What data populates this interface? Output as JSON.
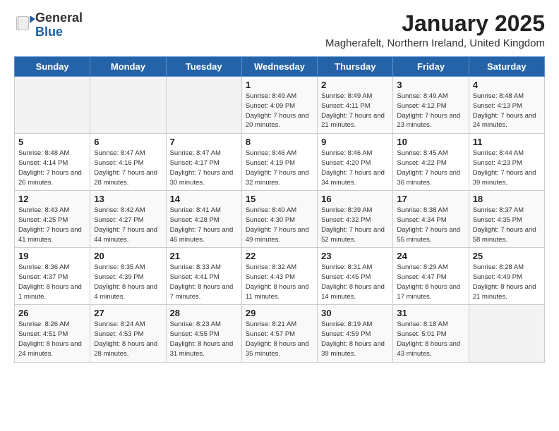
{
  "header": {
    "logo_general": "General",
    "logo_blue": "Blue",
    "month_year": "January 2025",
    "location": "Magherafelt, Northern Ireland, United Kingdom"
  },
  "weekdays": [
    "Sunday",
    "Monday",
    "Tuesday",
    "Wednesday",
    "Thursday",
    "Friday",
    "Saturday"
  ],
  "weeks": [
    [
      {
        "day": "",
        "info": ""
      },
      {
        "day": "",
        "info": ""
      },
      {
        "day": "",
        "info": ""
      },
      {
        "day": "1",
        "info": "Sunrise: 8:49 AM\nSunset: 4:09 PM\nDaylight: 7 hours\nand 20 minutes."
      },
      {
        "day": "2",
        "info": "Sunrise: 8:49 AM\nSunset: 4:11 PM\nDaylight: 7 hours\nand 21 minutes."
      },
      {
        "day": "3",
        "info": "Sunrise: 8:49 AM\nSunset: 4:12 PM\nDaylight: 7 hours\nand 23 minutes."
      },
      {
        "day": "4",
        "info": "Sunrise: 8:48 AM\nSunset: 4:13 PM\nDaylight: 7 hours\nand 24 minutes."
      }
    ],
    [
      {
        "day": "5",
        "info": "Sunrise: 8:48 AM\nSunset: 4:14 PM\nDaylight: 7 hours\nand 26 minutes."
      },
      {
        "day": "6",
        "info": "Sunrise: 8:47 AM\nSunset: 4:16 PM\nDaylight: 7 hours\nand 28 minutes."
      },
      {
        "day": "7",
        "info": "Sunrise: 8:47 AM\nSunset: 4:17 PM\nDaylight: 7 hours\nand 30 minutes."
      },
      {
        "day": "8",
        "info": "Sunrise: 8:46 AM\nSunset: 4:19 PM\nDaylight: 7 hours\nand 32 minutes."
      },
      {
        "day": "9",
        "info": "Sunrise: 8:46 AM\nSunset: 4:20 PM\nDaylight: 7 hours\nand 34 minutes."
      },
      {
        "day": "10",
        "info": "Sunrise: 8:45 AM\nSunset: 4:22 PM\nDaylight: 7 hours\nand 36 minutes."
      },
      {
        "day": "11",
        "info": "Sunrise: 8:44 AM\nSunset: 4:23 PM\nDaylight: 7 hours\nand 39 minutes."
      }
    ],
    [
      {
        "day": "12",
        "info": "Sunrise: 8:43 AM\nSunset: 4:25 PM\nDaylight: 7 hours\nand 41 minutes."
      },
      {
        "day": "13",
        "info": "Sunrise: 8:42 AM\nSunset: 4:27 PM\nDaylight: 7 hours\nand 44 minutes."
      },
      {
        "day": "14",
        "info": "Sunrise: 8:41 AM\nSunset: 4:28 PM\nDaylight: 7 hours\nand 46 minutes."
      },
      {
        "day": "15",
        "info": "Sunrise: 8:40 AM\nSunset: 4:30 PM\nDaylight: 7 hours\nand 49 minutes."
      },
      {
        "day": "16",
        "info": "Sunrise: 8:39 AM\nSunset: 4:32 PM\nDaylight: 7 hours\nand 52 minutes."
      },
      {
        "day": "17",
        "info": "Sunrise: 8:38 AM\nSunset: 4:34 PM\nDaylight: 7 hours\nand 55 minutes."
      },
      {
        "day": "18",
        "info": "Sunrise: 8:37 AM\nSunset: 4:35 PM\nDaylight: 7 hours\nand 58 minutes."
      }
    ],
    [
      {
        "day": "19",
        "info": "Sunrise: 8:36 AM\nSunset: 4:37 PM\nDaylight: 8 hours\nand 1 minute."
      },
      {
        "day": "20",
        "info": "Sunrise: 8:35 AM\nSunset: 4:39 PM\nDaylight: 8 hours\nand 4 minutes."
      },
      {
        "day": "21",
        "info": "Sunrise: 8:33 AM\nSunset: 4:41 PM\nDaylight: 8 hours\nand 7 minutes."
      },
      {
        "day": "22",
        "info": "Sunrise: 8:32 AM\nSunset: 4:43 PM\nDaylight: 8 hours\nand 11 minutes."
      },
      {
        "day": "23",
        "info": "Sunrise: 8:31 AM\nSunset: 4:45 PM\nDaylight: 8 hours\nand 14 minutes."
      },
      {
        "day": "24",
        "info": "Sunrise: 8:29 AM\nSunset: 4:47 PM\nDaylight: 8 hours\nand 17 minutes."
      },
      {
        "day": "25",
        "info": "Sunrise: 8:28 AM\nSunset: 4:49 PM\nDaylight: 8 hours\nand 21 minutes."
      }
    ],
    [
      {
        "day": "26",
        "info": "Sunrise: 8:26 AM\nSunset: 4:51 PM\nDaylight: 8 hours\nand 24 minutes."
      },
      {
        "day": "27",
        "info": "Sunrise: 8:24 AM\nSunset: 4:53 PM\nDaylight: 8 hours\nand 28 minutes."
      },
      {
        "day": "28",
        "info": "Sunrise: 8:23 AM\nSunset: 4:55 PM\nDaylight: 8 hours\nand 31 minutes."
      },
      {
        "day": "29",
        "info": "Sunrise: 8:21 AM\nSunset: 4:57 PM\nDaylight: 8 hours\nand 35 minutes."
      },
      {
        "day": "30",
        "info": "Sunrise: 8:19 AM\nSunset: 4:59 PM\nDaylight: 8 hours\nand 39 minutes."
      },
      {
        "day": "31",
        "info": "Sunrise: 8:18 AM\nSunset: 5:01 PM\nDaylight: 8 hours\nand 43 minutes."
      },
      {
        "day": "",
        "info": ""
      }
    ]
  ]
}
